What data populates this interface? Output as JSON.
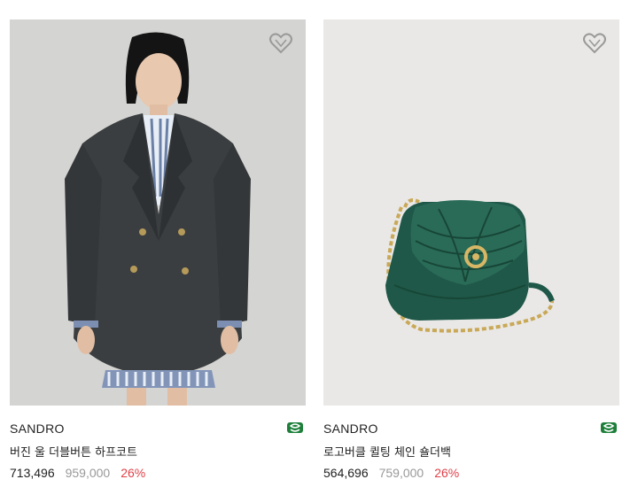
{
  "theme": {
    "discount_color": "#e0424a",
    "badge_color": "#1d7f3a",
    "icon_color": "#9a9a9a"
  },
  "products": [
    {
      "brand": "SANDRO",
      "name": "버진 울 더블버튼 하프코트",
      "sale_price": "713,496",
      "original_price": "959,000",
      "discount": "26%",
      "image_icon": "model-wearing-coat-image",
      "wishlist_icon": "heart-outline-icon",
      "badge_icon": "green-square-logo-icon"
    },
    {
      "brand": "SANDRO",
      "name": "로고버클 퀼팅 체인 숄더백",
      "sale_price": "564,696",
      "original_price": "759,000",
      "discount": "26%",
      "image_icon": "green-quilted-bag-image",
      "wishlist_icon": "heart-outline-icon",
      "badge_icon": "green-square-logo-icon"
    }
  ]
}
